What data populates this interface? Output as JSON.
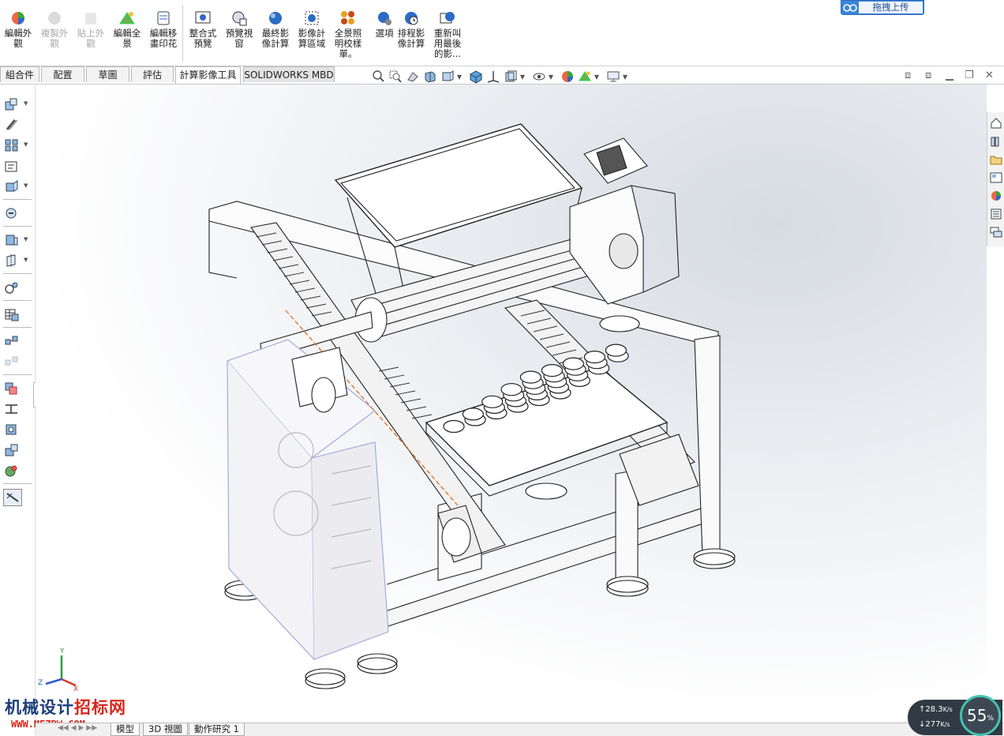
{
  "ribbon": {
    "buttons": [
      {
        "label": "編輯外\n觀",
        "icon": "edit-appearance-icon",
        "enabled": true
      },
      {
        "label": "複製外\n觀",
        "icon": "copy-appearance-icon",
        "enabled": false
      },
      {
        "label": "貼上外\n觀",
        "icon": "paste-appearance-icon",
        "enabled": false
      },
      {
        "label": "編輯全\n景",
        "icon": "edit-scene-icon",
        "enabled": true
      },
      {
        "label": "編輯移\n畫印花",
        "icon": "edit-decal-icon",
        "enabled": true
      },
      {
        "label": "整合式\n預覽",
        "icon": "integrated-preview-icon",
        "enabled": true
      },
      {
        "label": "預覽視\n窗",
        "icon": "preview-window-icon",
        "enabled": true
      },
      {
        "label": "最終影\n像計算",
        "icon": "final-render-icon",
        "enabled": true
      },
      {
        "label": "影像計\n算區域",
        "icon": "render-region-icon",
        "enabled": true
      },
      {
        "label": "全景照\n明校樣\n單。",
        "icon": "illumination-proof-icon",
        "enabled": true
      },
      {
        "label": "選項",
        "icon": "options-icon",
        "enabled": true
      },
      {
        "label": "排程影\n像計算",
        "icon": "schedule-render-icon",
        "enabled": true
      },
      {
        "label": "重新叫\n用最後\n的影...",
        "icon": "recall-last-render-icon",
        "enabled": true
      }
    ],
    "upload_label": "拖拽上传"
  },
  "tabs": [
    "組合件",
    "配置",
    "草圖",
    "評估",
    "計算影像工具",
    "SOLIDWORKS MBD"
  ],
  "active_tab": "計算影像工具",
  "bottom_tabs": [
    "模型",
    "3D 視圖",
    "動作研究 1"
  ],
  "watermark": {
    "line1_blue": "机械设计",
    "line1_red": "招标网",
    "line2": "WWW.MEZBW.COM"
  },
  "network": {
    "upload_speed": "28.3",
    "download_speed": "277",
    "unit": "K/s",
    "percent": "55",
    "percent_unit": "%"
  },
  "triad": {
    "x": "X",
    "y": "Y",
    "z": "Z"
  },
  "colors": {
    "accent_blue": "#3b84d8",
    "watermark_red": "#d9261c",
    "watermark_blue": "#1b3d7a",
    "net_ring": "#43c2b0"
  }
}
